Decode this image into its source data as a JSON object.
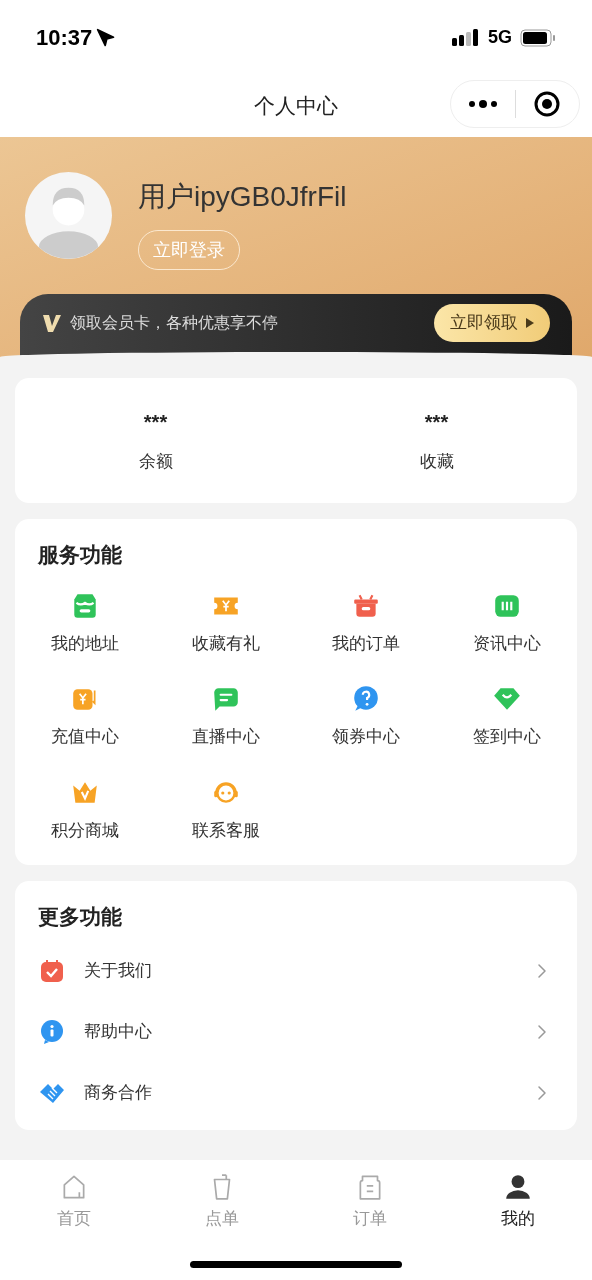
{
  "status_bar": {
    "time": "10:37",
    "network": "5G"
  },
  "nav": {
    "title": "个人中心"
  },
  "profile": {
    "username": "用户ipyGB0JfrFil",
    "login_button": "立即登录"
  },
  "member_banner": {
    "text": "领取会员卡，各种优惠享不停",
    "button": "立即领取"
  },
  "stats": [
    {
      "value": "***",
      "label": "余额"
    },
    {
      "value": "***",
      "label": "收藏"
    }
  ],
  "services": {
    "title": "服务功能",
    "items": [
      {
        "label": "我的地址"
      },
      {
        "label": "收藏有礼"
      },
      {
        "label": "我的订单"
      },
      {
        "label": "资讯中心"
      },
      {
        "label": "充值中心"
      },
      {
        "label": "直播中心"
      },
      {
        "label": "领券中心"
      },
      {
        "label": "签到中心"
      },
      {
        "label": "积分商城"
      },
      {
        "label": "联系客服"
      }
    ]
  },
  "more": {
    "title": "更多功能",
    "items": [
      {
        "label": "关于我们"
      },
      {
        "label": "帮助中心"
      },
      {
        "label": "商务合作"
      }
    ]
  },
  "tab_bar": [
    {
      "label": "首页",
      "selected": false
    },
    {
      "label": "点单",
      "selected": false
    },
    {
      "label": "订单",
      "selected": false
    },
    {
      "label": "我的",
      "selected": true
    }
  ]
}
